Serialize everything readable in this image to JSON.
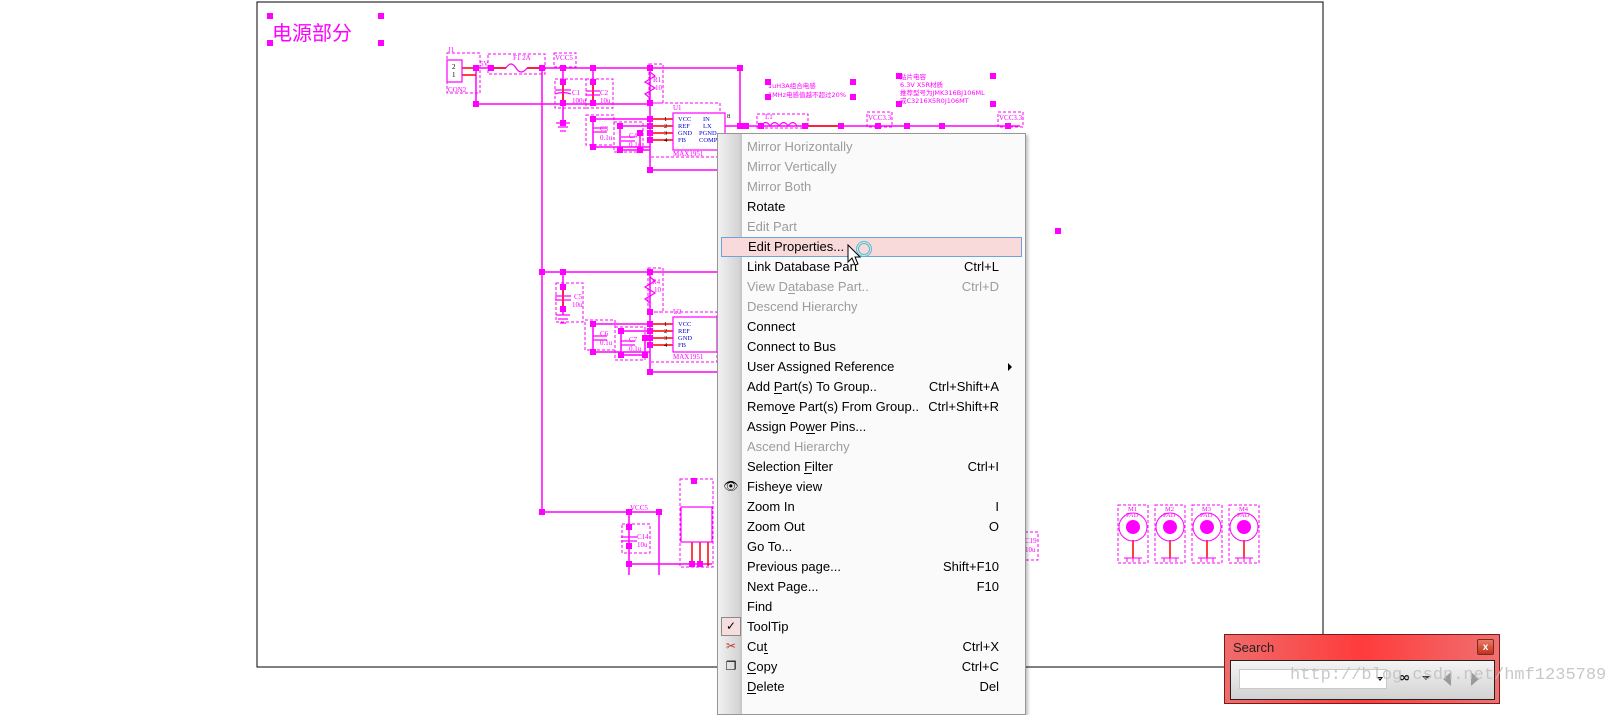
{
  "schematic": {
    "section_title": "电源部分",
    "connector": {
      "ref": "J1",
      "value": "CON2",
      "pin2": "2",
      "pin1": "1"
    },
    "net_5v": "5V",
    "fuse": "F1 2A",
    "vcc5": "VCC5",
    "vcc33": "VCC3.3",
    "c1": {
      "ref": "C1",
      "value": "100u"
    },
    "c2": {
      "ref": "C2",
      "value": "10u"
    },
    "c3": {
      "ref": "C3",
      "value": "0.1u"
    },
    "c4": {
      "ref": "C4",
      "value": "0.1u"
    },
    "c5": {
      "ref": "C5",
      "value": "10u"
    },
    "c6": {
      "ref": "C6",
      "value": "0.1u"
    },
    "c7": {
      "ref": "C7",
      "value": "0.1u"
    },
    "c14": {
      "ref": "C14",
      "value": "10u"
    },
    "c19": {
      "ref": "C19",
      "value": "10u"
    },
    "r1": {
      "ref": "R1",
      "value": "10"
    },
    "r4": {
      "ref": "R4",
      "value": "10"
    },
    "l1": {
      "ref": "L1",
      "value": "1uH"
    },
    "u1": {
      "ref": "U1",
      "part": "MAX1951"
    },
    "u2": {
      "ref": "U2",
      "part": "MAX1951"
    },
    "pins_left": [
      "VCC",
      "REF",
      "GND",
      "FB"
    ],
    "pin_nums_left": [
      "1",
      "2",
      "3",
      "4"
    ],
    "pins_right": [
      "IN",
      "LX",
      "PGND",
      "COMP"
    ],
    "pin_nums_right": [
      "8",
      "7",
      "6"
    ],
    "note_inductor": [
      "1uH3A组合电感",
      "1MHz电感值越不超过20%"
    ],
    "note_capacitor": [
      "贴片电容",
      "6.3V X5R材质",
      "推荐型号为JMK316BJ106ML",
      "或C3216X5R0J106MT"
    ],
    "pads": [
      {
        "ref": "M1",
        "label": "PAD"
      },
      {
        "ref": "M2",
        "label": "PAD"
      },
      {
        "ref": "M3",
        "label": "PAD"
      },
      {
        "ref": "M4",
        "label": "PAD"
      }
    ],
    "colors": {
      "component": "#ff00ff",
      "pin": "#ff0000",
      "border": "#000000"
    }
  },
  "context_menu": {
    "items": [
      {
        "label": "Mirror Horizontally",
        "shortcut": "",
        "disabled": true
      },
      {
        "label": "Mirror Vertically",
        "shortcut": "",
        "disabled": true
      },
      {
        "label": "Mirror Both",
        "shortcut": "",
        "disabled": true
      },
      {
        "label": "Rotate",
        "shortcut": "",
        "disabled": false
      },
      {
        "label": "Edit Part",
        "shortcut": "",
        "disabled": true
      },
      {
        "label": "Edit Properties...",
        "shortcut": "",
        "disabled": false,
        "highlighted": true
      },
      {
        "label": "Link Database Part",
        "shortcut": "Ctrl+L",
        "disabled": false
      },
      {
        "label": "View Database Part..",
        "shortcut": "Ctrl+D",
        "disabled": true,
        "mnemonic": 6
      },
      {
        "label": "Descend Hierarchy",
        "shortcut": "",
        "disabled": true
      },
      {
        "label": "Connect",
        "shortcut": "",
        "disabled": false
      },
      {
        "label": "Connect to Bus",
        "shortcut": "",
        "disabled": false
      },
      {
        "label": "User Assigned Reference",
        "shortcut": "",
        "disabled": false,
        "submenu": true
      },
      {
        "label": "Add Part(s) To Group..",
        "shortcut": "Ctrl+Shift+A",
        "disabled": false,
        "mnemonic": 4
      },
      {
        "label": "Remove Part(s) From Group..",
        "shortcut": "Ctrl+Shift+R",
        "disabled": false,
        "mnemonic": 4
      },
      {
        "label": "Assign Power Pins...",
        "shortcut": "",
        "disabled": false,
        "mnemonic": 9
      },
      {
        "label": "Ascend Hierarchy",
        "shortcut": "",
        "disabled": true
      },
      {
        "label": "Selection Filter",
        "shortcut": "Ctrl+I",
        "disabled": false,
        "mnemonic": 10
      },
      {
        "label": "Fisheye view",
        "shortcut": "",
        "disabled": false,
        "icon": "eye-icon"
      },
      {
        "label": "Zoom In",
        "shortcut": "I",
        "disabled": false
      },
      {
        "label": "Zoom Out",
        "shortcut": "O",
        "disabled": false
      },
      {
        "label": "Go To...",
        "shortcut": "",
        "disabled": false
      },
      {
        "label": "Previous page...",
        "shortcut": "Shift+F10",
        "disabled": false
      },
      {
        "label": "Next Page...",
        "shortcut": "F10",
        "disabled": false
      },
      {
        "label": "Find",
        "shortcut": "",
        "disabled": false
      },
      {
        "label": "ToolTip",
        "shortcut": "",
        "disabled": false,
        "icon": "checkmark-icon",
        "checked": true
      },
      {
        "label": "Cut",
        "shortcut": "Ctrl+X",
        "disabled": false,
        "mnemonic": 2,
        "icon": "scissors-icon"
      },
      {
        "label": "Copy",
        "shortcut": "Ctrl+C",
        "disabled": false,
        "mnemonic": 0,
        "icon": "copy-icon"
      },
      {
        "label": "Delete",
        "shortcut": "Del",
        "disabled": false,
        "mnemonic": 0
      }
    ]
  },
  "search_panel": {
    "title": "Search",
    "close_label": "x",
    "input_value": "",
    "accent": "#ff3b3b"
  },
  "watermark": "http://blog.csdn.net/hmf1235789"
}
